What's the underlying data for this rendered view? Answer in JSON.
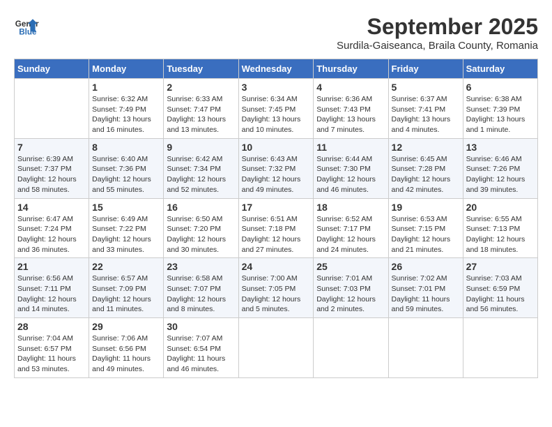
{
  "logo": {
    "line1": "General",
    "line2": "Blue"
  },
  "title": "September 2025",
  "subtitle": "Surdila-Gaiseanca, Braila County, Romania",
  "days_header": [
    "Sunday",
    "Monday",
    "Tuesday",
    "Wednesday",
    "Thursday",
    "Friday",
    "Saturday"
  ],
  "weeks": [
    [
      {
        "day": "",
        "sunrise": "",
        "sunset": "",
        "daylight": ""
      },
      {
        "day": "1",
        "sunrise": "6:32 AM",
        "sunset": "7:49 PM",
        "daylight": "13 hours and 16 minutes."
      },
      {
        "day": "2",
        "sunrise": "6:33 AM",
        "sunset": "7:47 PM",
        "daylight": "13 hours and 13 minutes."
      },
      {
        "day": "3",
        "sunrise": "6:34 AM",
        "sunset": "7:45 PM",
        "daylight": "13 hours and 10 minutes."
      },
      {
        "day": "4",
        "sunrise": "6:36 AM",
        "sunset": "7:43 PM",
        "daylight": "13 hours and 7 minutes."
      },
      {
        "day": "5",
        "sunrise": "6:37 AM",
        "sunset": "7:41 PM",
        "daylight": "13 hours and 4 minutes."
      },
      {
        "day": "6",
        "sunrise": "6:38 AM",
        "sunset": "7:39 PM",
        "daylight": "13 hours and 1 minute."
      }
    ],
    [
      {
        "day": "7",
        "sunrise": "6:39 AM",
        "sunset": "7:37 PM",
        "daylight": "12 hours and 58 minutes."
      },
      {
        "day": "8",
        "sunrise": "6:40 AM",
        "sunset": "7:36 PM",
        "daylight": "12 hours and 55 minutes."
      },
      {
        "day": "9",
        "sunrise": "6:42 AM",
        "sunset": "7:34 PM",
        "daylight": "12 hours and 52 minutes."
      },
      {
        "day": "10",
        "sunrise": "6:43 AM",
        "sunset": "7:32 PM",
        "daylight": "12 hours and 49 minutes."
      },
      {
        "day": "11",
        "sunrise": "6:44 AM",
        "sunset": "7:30 PM",
        "daylight": "12 hours and 46 minutes."
      },
      {
        "day": "12",
        "sunrise": "6:45 AM",
        "sunset": "7:28 PM",
        "daylight": "12 hours and 42 minutes."
      },
      {
        "day": "13",
        "sunrise": "6:46 AM",
        "sunset": "7:26 PM",
        "daylight": "12 hours and 39 minutes."
      }
    ],
    [
      {
        "day": "14",
        "sunrise": "6:47 AM",
        "sunset": "7:24 PM",
        "daylight": "12 hours and 36 minutes."
      },
      {
        "day": "15",
        "sunrise": "6:49 AM",
        "sunset": "7:22 PM",
        "daylight": "12 hours and 33 minutes."
      },
      {
        "day": "16",
        "sunrise": "6:50 AM",
        "sunset": "7:20 PM",
        "daylight": "12 hours and 30 minutes."
      },
      {
        "day": "17",
        "sunrise": "6:51 AM",
        "sunset": "7:18 PM",
        "daylight": "12 hours and 27 minutes."
      },
      {
        "day": "18",
        "sunrise": "6:52 AM",
        "sunset": "7:17 PM",
        "daylight": "12 hours and 24 minutes."
      },
      {
        "day": "19",
        "sunrise": "6:53 AM",
        "sunset": "7:15 PM",
        "daylight": "12 hours and 21 minutes."
      },
      {
        "day": "20",
        "sunrise": "6:55 AM",
        "sunset": "7:13 PM",
        "daylight": "12 hours and 18 minutes."
      }
    ],
    [
      {
        "day": "21",
        "sunrise": "6:56 AM",
        "sunset": "7:11 PM",
        "daylight": "12 hours and 14 minutes."
      },
      {
        "day": "22",
        "sunrise": "6:57 AM",
        "sunset": "7:09 PM",
        "daylight": "12 hours and 11 minutes."
      },
      {
        "day": "23",
        "sunrise": "6:58 AM",
        "sunset": "7:07 PM",
        "daylight": "12 hours and 8 minutes."
      },
      {
        "day": "24",
        "sunrise": "7:00 AM",
        "sunset": "7:05 PM",
        "daylight": "12 hours and 5 minutes."
      },
      {
        "day": "25",
        "sunrise": "7:01 AM",
        "sunset": "7:03 PM",
        "daylight": "12 hours and 2 minutes."
      },
      {
        "day": "26",
        "sunrise": "7:02 AM",
        "sunset": "7:01 PM",
        "daylight": "11 hours and 59 minutes."
      },
      {
        "day": "27",
        "sunrise": "7:03 AM",
        "sunset": "6:59 PM",
        "daylight": "11 hours and 56 minutes."
      }
    ],
    [
      {
        "day": "28",
        "sunrise": "7:04 AM",
        "sunset": "6:57 PM",
        "daylight": "11 hours and 53 minutes."
      },
      {
        "day": "29",
        "sunrise": "7:06 AM",
        "sunset": "6:56 PM",
        "daylight": "11 hours and 49 minutes."
      },
      {
        "day": "30",
        "sunrise": "7:07 AM",
        "sunset": "6:54 PM",
        "daylight": "11 hours and 46 minutes."
      },
      {
        "day": "",
        "sunrise": "",
        "sunset": "",
        "daylight": ""
      },
      {
        "day": "",
        "sunrise": "",
        "sunset": "",
        "daylight": ""
      },
      {
        "day": "",
        "sunrise": "",
        "sunset": "",
        "daylight": ""
      },
      {
        "day": "",
        "sunrise": "",
        "sunset": "",
        "daylight": ""
      }
    ]
  ]
}
